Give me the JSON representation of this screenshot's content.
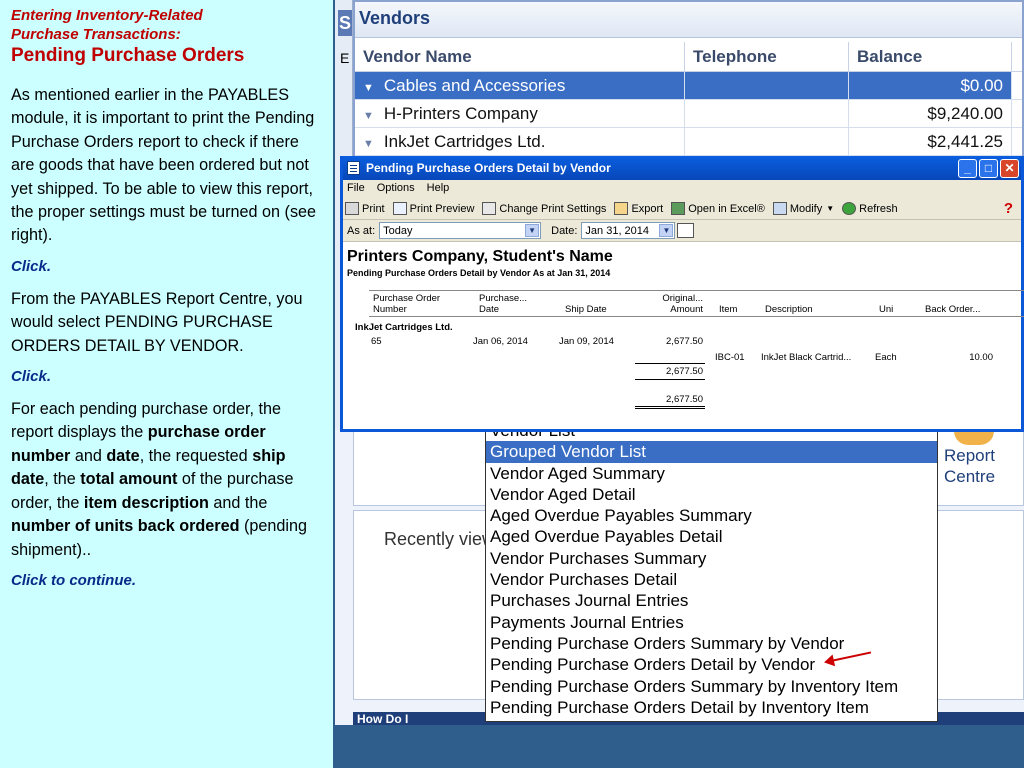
{
  "slide": {
    "kicker_line1": "Entering Inventory-Related",
    "kicker_line2": "Purchase Transactions:",
    "heading": "Pending Purchase Orders",
    "para1": "As mentioned earlier in the PAYABLES module, it is important to print the Pending Purchase Orders report to check if there are goods that have been ordered but not yet shipped. To be able to view this report, the proper settings must be turned on (see right).",
    "click1": "Click.",
    "para2": "From the PAYABLES Report Centre, you would select PENDING PURCHASE ORDERS DETAIL BY VENDOR.",
    "click2": "Click.",
    "para3": {
      "t1": "For each pending purchase order, the report displays the ",
      "b1": "purchase order number",
      "t2": " and ",
      "b2": "date",
      "t3": ", the requested ",
      "b3": "ship date",
      "t4": ", the ",
      "b4": "total amount",
      "t5": " of the purchase order, the ",
      "b5": "item description",
      "t6": " and the ",
      "b6": "number of units back ordered",
      "t7": " (pending shipment).."
    },
    "click3": "Click to continue."
  },
  "background": {
    "side_s": "S",
    "side_e": "E",
    "vendors": {
      "title": "Vendors",
      "columns": [
        "Vendor Name",
        "Telephone",
        "Balance"
      ],
      "rows": [
        {
          "name": "Cables and Accessories",
          "tel": "",
          "balance": "$0.00"
        },
        {
          "name": "H-Printers Company",
          "tel": "",
          "balance": "$9,240.00"
        },
        {
          "name": "InkJet Cartridges Ltd.",
          "tel": "",
          "balance": "$2,441.25"
        }
      ]
    },
    "recent": "Recently view",
    "report_centre_1": "Report",
    "report_centre_2": "Centre",
    "how_do_i": "How Do I"
  },
  "dropdown": {
    "items": [
      "Vendor List",
      "Grouped Vendor List",
      "Vendor Aged Summary",
      "Vendor Aged Detail",
      "Aged Overdue Payables Summary",
      "Aged Overdue Payables Detail",
      "Vendor Purchases Summary",
      "Vendor Purchases Detail",
      "Purchases Journal Entries",
      "Payments Journal Entries",
      "Pending Purchase Orders Summary by Vendor",
      "Pending Purchase Orders Detail by Vendor",
      "Pending Purchase Orders Summary by Inventory Item",
      "Pending Purchase Orders Detail by Inventory Item"
    ]
  },
  "dialog": {
    "title": "Pending Purchase Orders Detail by Vendor",
    "minimize": "_",
    "maximize": "□",
    "close": "✕",
    "menu": [
      "File",
      "Options",
      "Help"
    ],
    "toolbar": {
      "print": "Print",
      "preview": "Print Preview",
      "settings": "Change Print Settings",
      "export": "Export",
      "excel": "Open in Excel®",
      "modify": "Modify",
      "refresh": "Refresh",
      "help": "?"
    },
    "as_at_label": "As at:",
    "as_at_value": "Today",
    "date_label": "Date:",
    "date_value": "Jan 31, 2014",
    "report": {
      "company": "Printers Company, Student's Name",
      "subtitle": "Pending Purchase Orders Detail by Vendor As at Jan 31, 2014",
      "columns": {
        "po1": "Purchase Order",
        "po2": "Number",
        "date1": "Purchase...",
        "date2": "Date",
        "ship": "Ship Date",
        "amt1": "Original...",
        "amt2": "Amount",
        "item": "Item",
        "desc": "Description",
        "unit": "Uni",
        "back": "Back Order..."
      },
      "vendor": "InkJet Cartridges Ltd.",
      "po_number": "65",
      "po_date": "Jan 06, 2014",
      "ship_date": "Jan 09, 2014",
      "amount": "2,677.50",
      "item_code": "IBC-01",
      "item_desc": "InkJet Black Cartrid...",
      "unit": "Each",
      "back_order": "10.00",
      "subtotal": "2,677.50",
      "total": "2,677.50"
    }
  }
}
